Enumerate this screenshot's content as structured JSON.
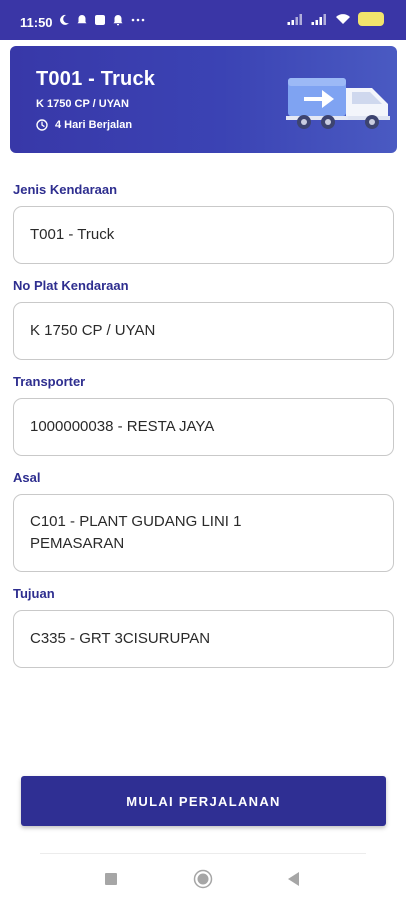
{
  "status_bar": {
    "time": "11:50",
    "battery": "",
    "left_icons": [
      "moon-icon",
      "notification-icon",
      "square-notification-icon",
      "bell-icon",
      "more-icon"
    ],
    "right_icons": [
      "signal-icon",
      "signal-icon",
      "wifi-icon",
      "battery-icon"
    ]
  },
  "header": {
    "title": "T001 - Truck",
    "plate": "K 1750 CP / UYAN",
    "duration": "4 Hari Berjalan",
    "duration_icon": "clock-icon",
    "illustration_icon": "truck-icon"
  },
  "form": {
    "jenis_label": "Jenis Kendaraan",
    "jenis_value": "T001 - Truck",
    "plat_label": "No Plat Kendaraan",
    "plat_value": "K 1750 CP / UYAN",
    "transporter_label": "Transporter",
    "transporter_value": "1000000038 - RESTA JAYA",
    "asal_label": "Asal",
    "asal_value": "C101 - PLANT GUDANG LINI 1 PEMASARAN",
    "tujuan_label": "Tujuan",
    "tujuan_value": "C335 - GRT 3CISURUPAN"
  },
  "actions": {
    "start_label": "MULAI PERJALANAN"
  },
  "colors": {
    "primary": "#2f2f93",
    "header_gradient_start": "#3838a8",
    "header_gradient_end": "#4a5ac2",
    "label": "#2e2e8f"
  },
  "nav": {
    "icons": [
      "recent-apps-icon",
      "home-icon",
      "back-icon"
    ]
  }
}
